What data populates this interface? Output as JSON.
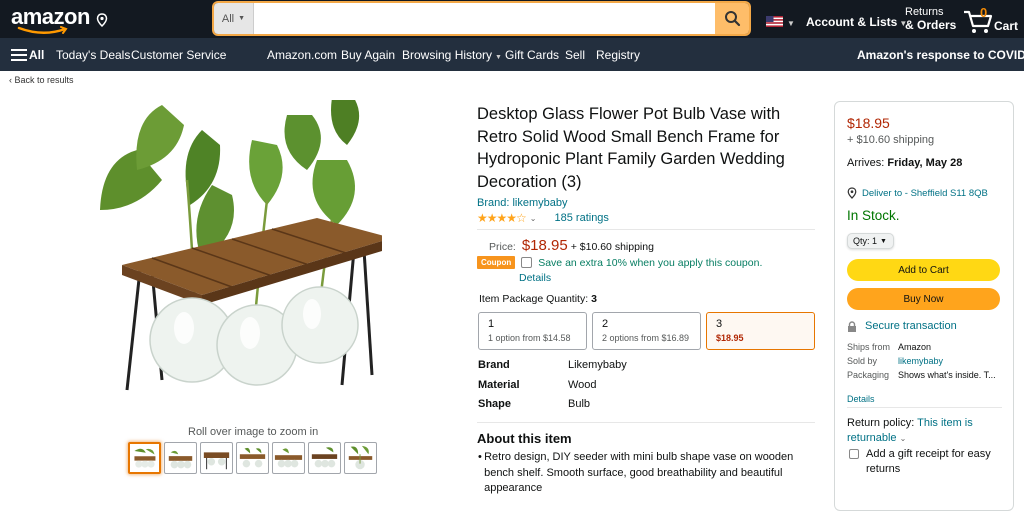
{
  "nav": {
    "logo": "amazon",
    "search_dept": "All",
    "search_placeholder": "",
    "account_label": "Account & Lists",
    "returns_line1": "Returns",
    "returns_line2": "& Orders",
    "cart_count": "0",
    "cart_label": "Cart"
  },
  "subnav": {
    "all": "All",
    "items": [
      "Today's Deals",
      "Customer Service",
      "Amazon.com",
      "Buy Again",
      "Browsing History",
      "Gift Cards",
      "Sell",
      "Registry"
    ],
    "covid": "Amazon's response to COVID-19"
  },
  "back_link": "‹ Back to results",
  "gallery": {
    "zoom_hint": "Roll over image to zoom in"
  },
  "product": {
    "title": "Desktop Glass Flower Pot Bulb Vase with Retro Solid Wood Small Bench Frame for Hydroponic Plant Family Garden Wedding Decoration (3)",
    "brand": "Brand: likemybaby",
    "stars_value": 4,
    "stars_glyphs": "★★★★☆",
    "ratings": "185 ratings",
    "price_label": "Price:",
    "price": "$18.95",
    "shipping": "+ $10.60 shipping",
    "coupon_badge": "Coupon",
    "coupon_text": "Save an extra 10% when you apply this coupon.",
    "coupon_details": "Details",
    "ipq_label": "Item Package Quantity:",
    "ipq_value": "3",
    "options": [
      {
        "n": "1",
        "s": "1 option from $14.58"
      },
      {
        "n": "2",
        "s": "2 options from $16.89"
      },
      {
        "n": "3",
        "s": "$18.95"
      }
    ],
    "specs": [
      {
        "k": "Brand",
        "v": "Likemybaby"
      },
      {
        "k": "Material",
        "v": "Wood"
      },
      {
        "k": "Shape",
        "v": "Bulb"
      }
    ],
    "about_heading": "About this item",
    "bullet1": "Retro design, DIY seeder with mini bulb shape vase on wooden bench shelf. Smooth surface, good breathability and beautiful appearance"
  },
  "buybox": {
    "price": "$18.95",
    "shipping": "+ $10.60 shipping",
    "arrives_label": "Arrives:",
    "arrives_date": "Friday, May 28",
    "deliver_to": "Deliver to - Sheffield S11 8QB",
    "stock": "In Stock.",
    "qty": "Qty: 1",
    "add_to_cart": "Add to Cart",
    "buy_now": "Buy Now",
    "secure": "Secure transaction",
    "ships_from_k": "Ships from",
    "ships_from_v": "Amazon",
    "sold_by_k": "Sold by",
    "sold_by_v": "likemybaby",
    "packaging_k": "Packaging",
    "packaging_v": "Shows what's inside. T...",
    "details": "Details",
    "return_label": "Return policy:",
    "return_link": "This item is returnable",
    "gift_receipt": "Add a gift receipt for easy returns"
  },
  "colors": {
    "nav_dark": "#131921",
    "nav_mid": "#232f3e",
    "price_red": "#b12704",
    "link": "#007185",
    "stock_green": "#007600",
    "cart_yellow": "#ffd814",
    "buy_orange": "#ffa41c"
  }
}
